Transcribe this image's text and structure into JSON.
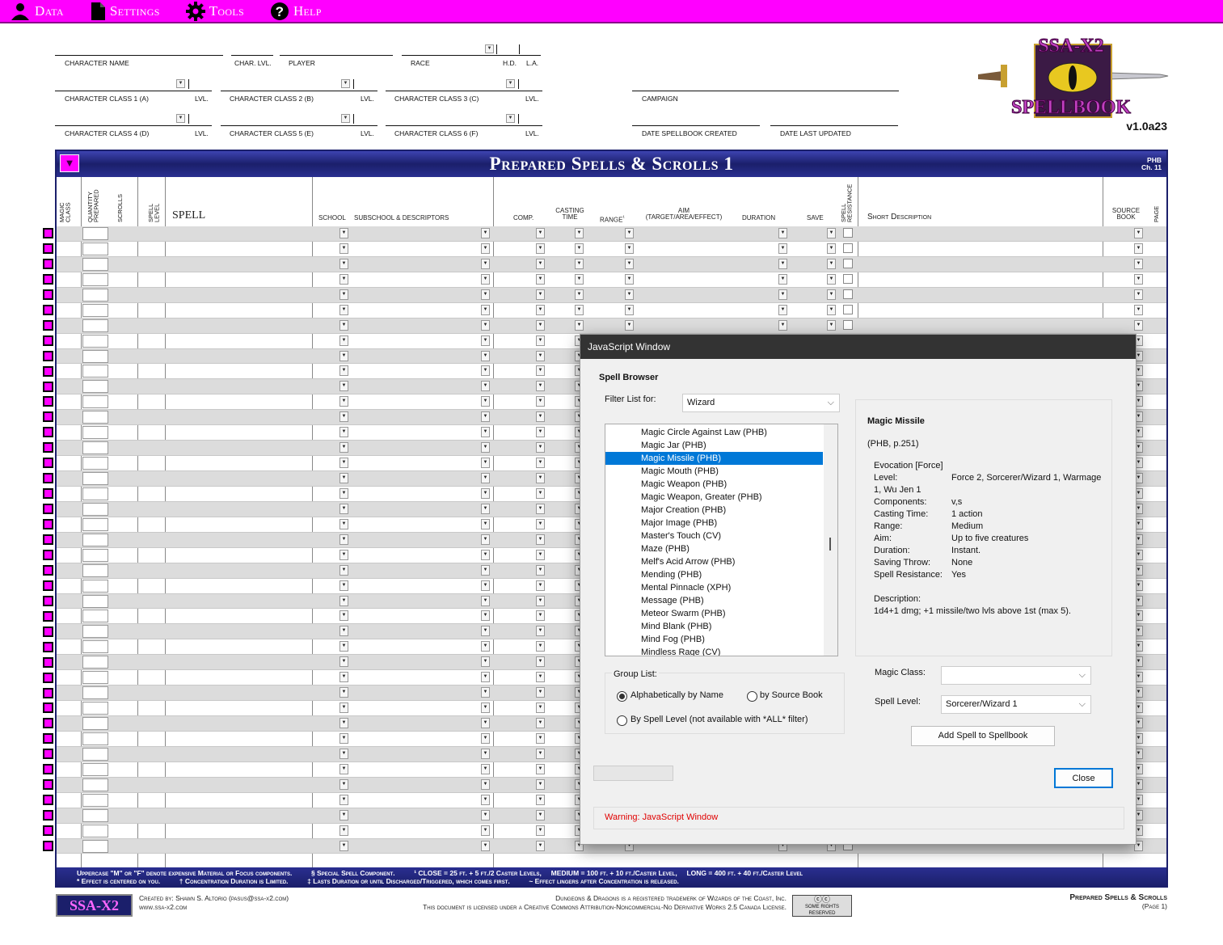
{
  "menu": {
    "items": [
      {
        "label": "Data",
        "icon": "person-icon"
      },
      {
        "label": "Settings",
        "icon": "document-icon"
      },
      {
        "label": "Tools",
        "icon": "gear-icon"
      },
      {
        "label": "Help",
        "icon": "question-icon"
      }
    ]
  },
  "header": {
    "character_name": "CHARACTER NAME",
    "char_lvl": "CHAR. LVL.",
    "player": "PLAYER",
    "race": "RACE",
    "hd": "H.D.",
    "la": "L.A.",
    "class1": "CHARACTER CLASS 1 (A)",
    "class2": "CHARACTER CLASS 2 (B)",
    "class3": "CHARACTER CLASS 3 (C)",
    "class4": "CHARACTER CLASS 4 (D)",
    "class5": "CHARACTER CLASS 5 (E)",
    "class6": "CHARACTER CLASS 6 (F)",
    "lvl": "LVL.",
    "campaign": "CAMPAIGN",
    "date_created": "DATE SPELLBOOK CREATED",
    "date_updated": "DATE LAST UPDATED"
  },
  "logo": {
    "top": "SSA-X2",
    "bottom": "SPELLBOOK",
    "version": "v1.0a23"
  },
  "sheet": {
    "title": "Prepared Spells & Scrolls 1",
    "ref_line1": "PHB",
    "ref_line2": "Ch. 11",
    "columns": {
      "magic_class": "Magic Class",
      "quantity_prepared": "Quantity Prepared",
      "scrolls": "Scrolls",
      "spell_level": "Spell Level",
      "spell": "Spell",
      "school": "School",
      "subschool": "Subschool & Descriptors",
      "comp": "Comp.",
      "casting_time": "Casting Time",
      "range": "Range",
      "range_mark": "¹",
      "aim": "Aim (Target/Area/Effect)",
      "duration": "Duration",
      "save": "Save",
      "spell_resistance": "Spell Resistance",
      "short_description": "Short Description",
      "source_book": "Source Book",
      "page": "Page"
    },
    "footer_line1": "Uppercase \"M\" or \"F\" denote expensive Material or Focus components.          § Special Spell Component.          ¹ CLOSE = 25 ft. + 5 ft./2 Caster Levels,     MEDIUM = 100 ft. + 10 ft./Caster Level,     LONG = 400 ft. + 40 ft./Caster Level",
    "footer_line2": "* Effect is centered on you.          † Concentration Duration is Limited.          ‡ Lasts Duration or until Discharged/Triggered, which comes first.          ~ Effect lingers after Concentration is released."
  },
  "credits": {
    "badge": "SSA-X2",
    "created_by": "Created by: Shawn S. Altorio  (pasus@ssa-x2.com)",
    "website": "www.ssa-x2.com",
    "trademark": "Dungeons & Dragons is a registered trademerk of Wizards of the Coast, Inc.",
    "license": "This document is licensed under a Creative Commons Attribution-Noncommercial-No Derivative Works 2.5 Canada License.",
    "cc_badge": "SOME RIGHTS RESERVED",
    "page_title": "Prepared Spells & Scrolls",
    "page_number": "(Page 1)"
  },
  "dialog": {
    "title": "JavaScript Window",
    "group_title": "Spell Browser",
    "filter_label": "Filter List for:",
    "filter_value": "Wizard",
    "spells": [
      "Magic Circle Against Law (PHB)",
      "Magic Jar (PHB)",
      "Magic Missile (PHB)",
      "Magic Mouth (PHB)",
      "Magic Weapon (PHB)",
      "Magic Weapon, Greater (PHB)",
      "Major Creation (PHB)",
      "Major Image (PHB)",
      "Master's Touch (CV)",
      "Maze (PHB)",
      "Melf's Acid Arrow (PHB)",
      "Mending (PHB)",
      "Mental Pinnacle (XPH)",
      "Message (PHB)",
      "Meteor Swarm (PHB)",
      "Mind Blank (PHB)",
      "Mind Fog (PHB)",
      "Mindless Rage (CV)"
    ],
    "selected_index": 2,
    "info": {
      "name": "Magic Missile",
      "source": "(PHB, p.251)",
      "school": "Evocation [Force]",
      "level_label": "Level:",
      "level_value": "Force 2, Sorcerer/Wizard 1, Warmage",
      "level_value2": "1, Wu Jen 1",
      "components_label": "Components:",
      "components_value": "v,s",
      "casting_label": "Casting Time:",
      "casting_value": "1 action",
      "range_label": "Range:",
      "range_value": "Medium",
      "aim_label": "Aim:",
      "aim_value": "Up to five creatures",
      "duration_label": "Duration:",
      "duration_value": "Instant.",
      "saving_label": "Saving Throw:",
      "saving_value": "None",
      "sr_label": "Spell Resistance:",
      "sr_value": "Yes",
      "description_label": "Description:",
      "description_value": "1d4+1 dmg; +1 missile/two lvls above 1st (max 5)."
    },
    "group_list_label": "Group List:",
    "radio_alpha": "Alphabetically by Name",
    "radio_source": "by Source Book",
    "radio_level": "By Spell Level (not available with *ALL* filter)",
    "magic_class_label": "Magic Class:",
    "magic_class_value": "",
    "spell_level_label": "Spell Level:",
    "spell_level_value": "Sorcerer/Wizard 1",
    "add_button": "Add Spell to Spellbook",
    "close_button": "Close",
    "warning": "Warning: JavaScript Window"
  },
  "colors": {
    "accent": "#ff00ff",
    "navy": "#1b1f6b",
    "warning": "#e00000",
    "selection": "#0078d7"
  }
}
